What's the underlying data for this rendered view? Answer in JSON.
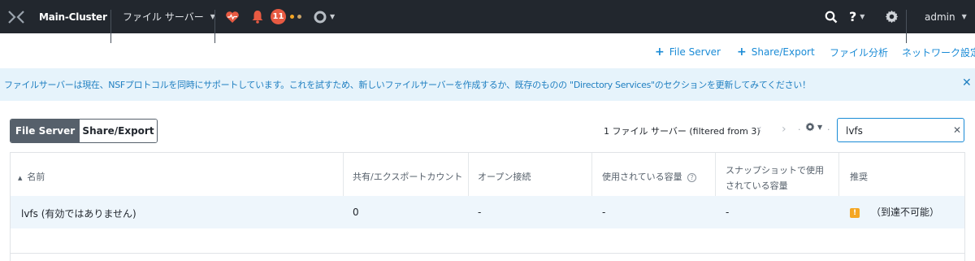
{
  "topbar": {
    "cluster_name": "Main-Cluster",
    "entity_menu": "ファイル サーバー",
    "alert_count": "11",
    "user": "admin",
    "help_glyph": "?"
  },
  "actions": {
    "add_file_server": "File Server",
    "add_share_export": "Share/Export",
    "file_analytics": "ファイル分析",
    "network_config": "ネットワーク設定"
  },
  "banner": {
    "message": "ファイルサーバーは現在、NSFプロトコルを同時にサポートしています。これを試すため、新しいファイルサーバーを作成するか、既存のものの \"Directory Services\"のセクションを更新してみてください！"
  },
  "view_toggle": {
    "active": "File Server",
    "inactive": "Share/Export"
  },
  "table_controls": {
    "count_text": "1 ファイル サーバー (filtered from 3)",
    "filter_value": "lvfs"
  },
  "table": {
    "columns": [
      "名前",
      "共有/エクスポートカウント",
      "オープン接続",
      "使用されている容量",
      "スナップショットで使用されている容量",
      "推奨"
    ],
    "rows": [
      {
        "name": "lvfs (有効ではありません)",
        "share_count": "0",
        "open_connections": "-",
        "used_capacity": "-",
        "snapshot_capacity": "-",
        "recommendation": "（到達不可能）"
      }
    ]
  }
}
